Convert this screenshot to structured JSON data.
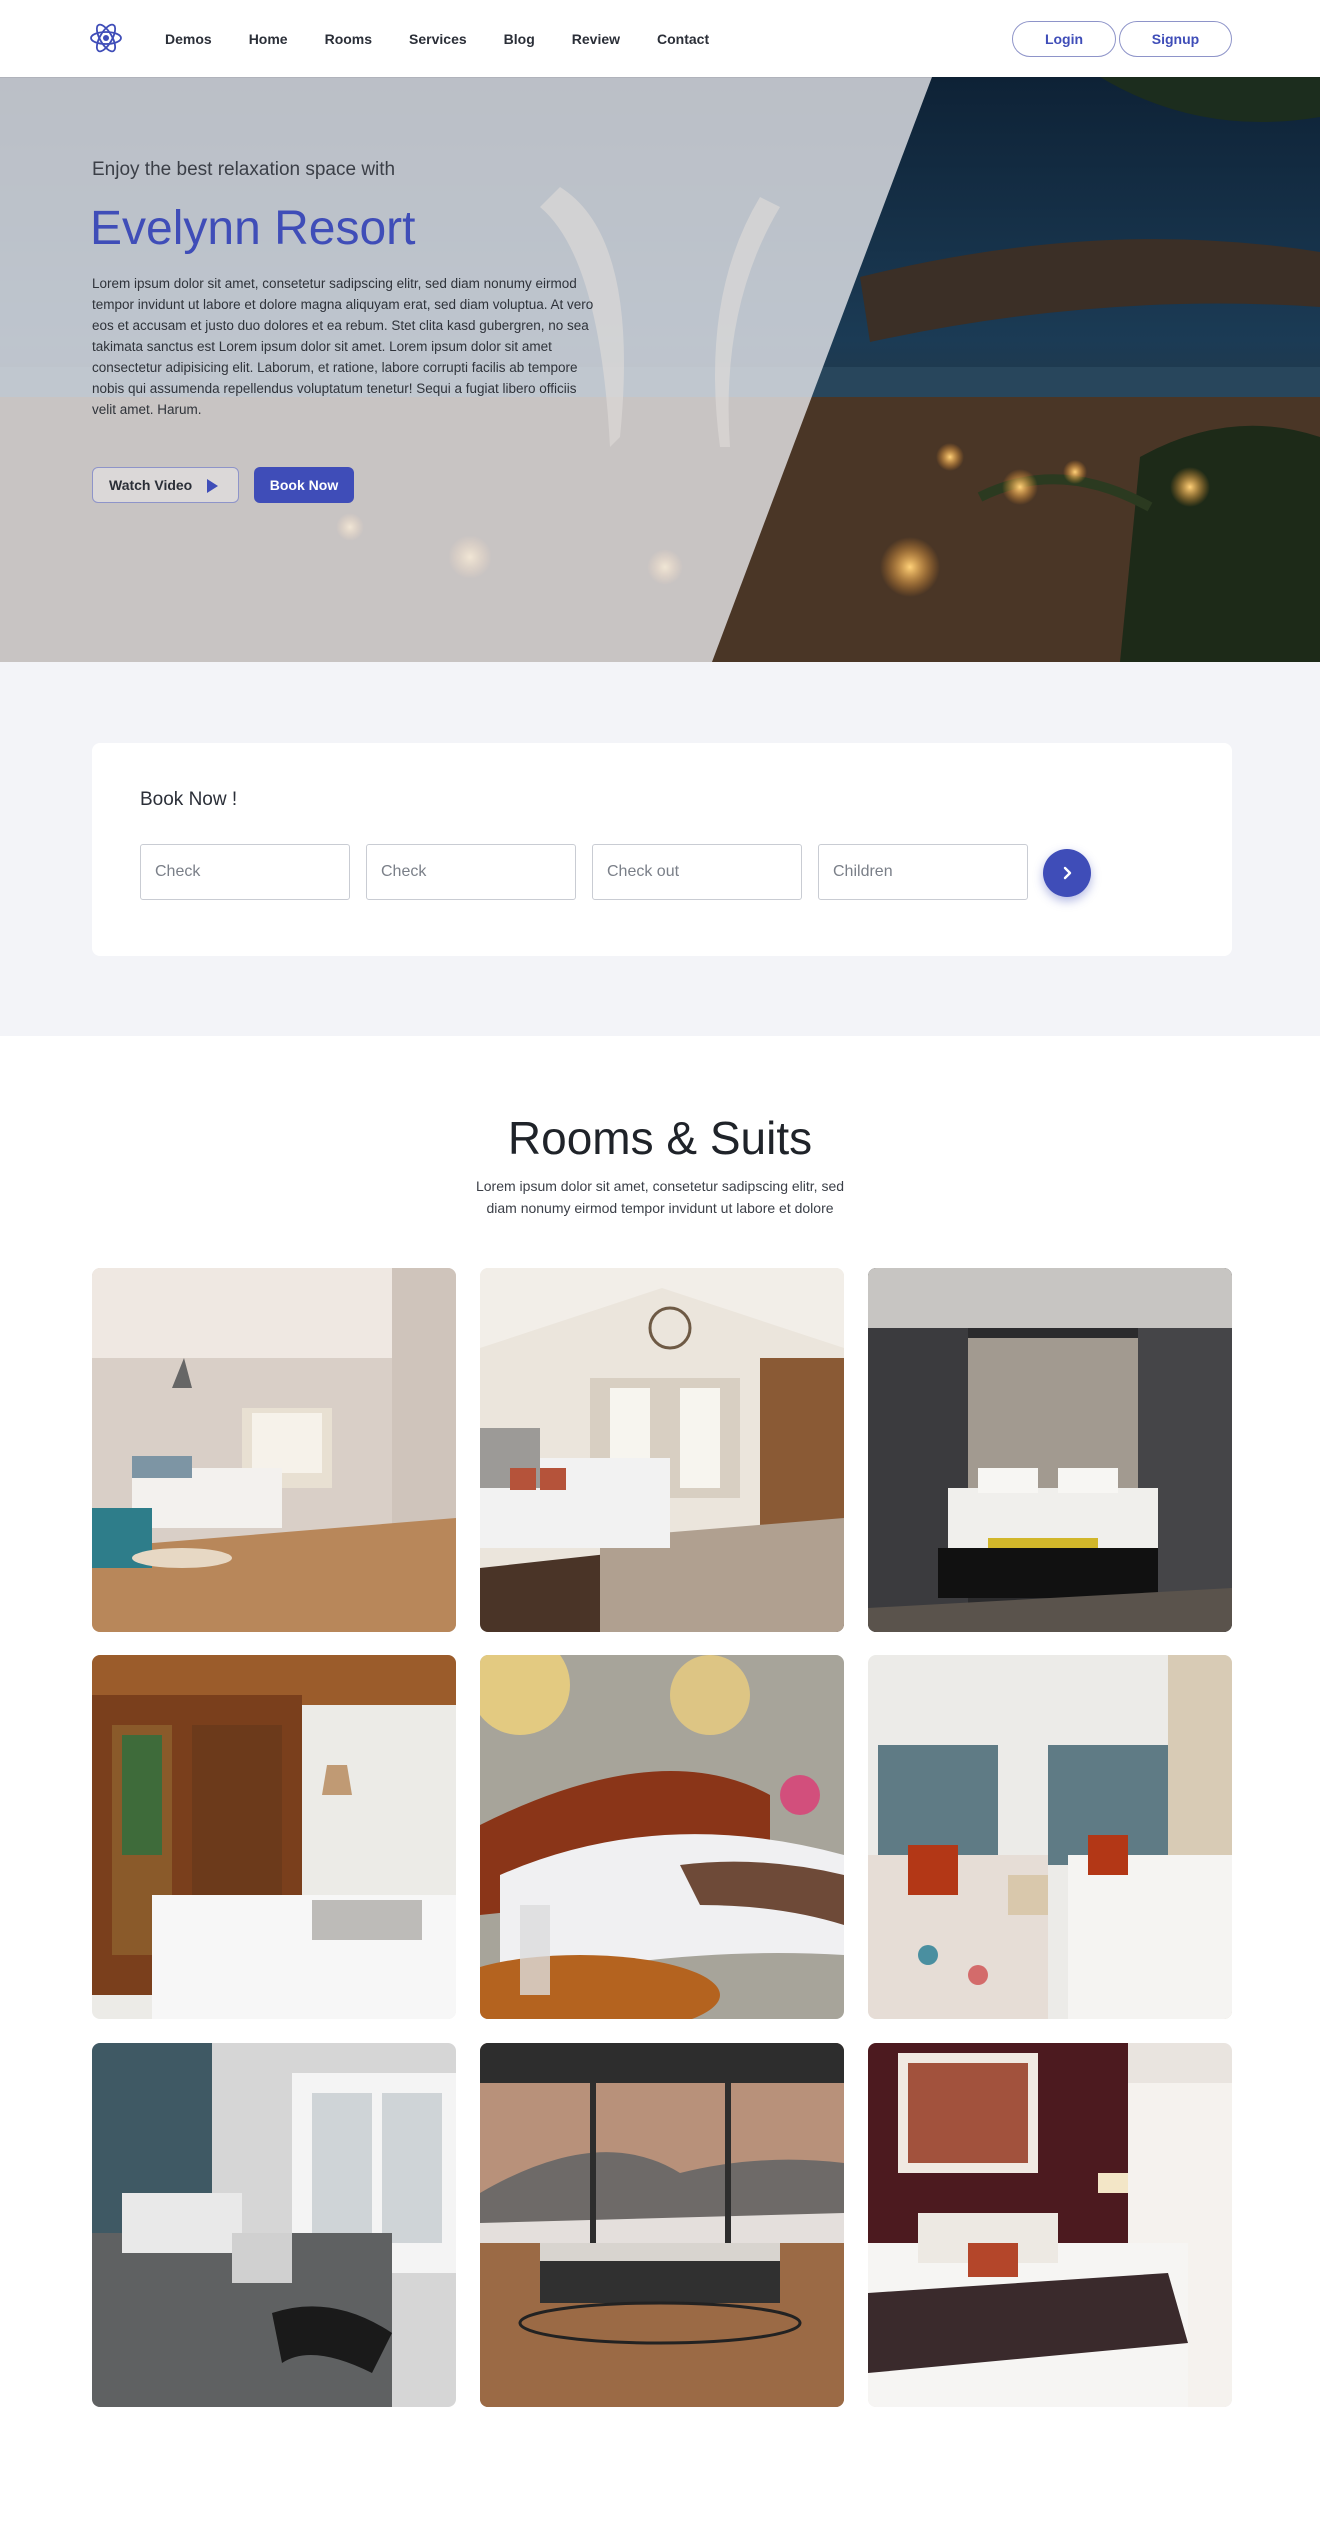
{
  "nav": {
    "logo_icon": "atom-logo-icon",
    "items": [
      "Demos",
      "Home",
      "Rooms",
      "Services",
      "Blog",
      "Review",
      "Contact"
    ],
    "login_label": "Login",
    "signup_label": "Signup"
  },
  "hero": {
    "tagline": "Enjoy the best relaxation space with",
    "title": "Evelynn Resort",
    "description": "Lorem ipsum dolor sit amet, consetetur sadipscing elitr, sed diam nonumy eirmod tempor invidunt ut labore et dolore magna aliquyam erat, sed diam voluptua. At vero eos et accusam et justo duo dolores et ea rebum. Stet clita kasd gubergren, no sea takimata sanctus est Lorem ipsum dolor sit amet. Lorem ipsum dolor sit amet consectetur adipisicing elit. Laborum, et ratione, labore corrupti facilis ab tempore nobis qui assumenda repellendus voluptatum tenetur! Sequi a fugiat libero officiis velit amet. Harum.",
    "watch_video_label": "Watch Video",
    "book_now_label": "Book Now"
  },
  "booking": {
    "title": "Book Now !",
    "fields": [
      {
        "placeholder": "Check"
      },
      {
        "placeholder": "Check"
      },
      {
        "placeholder": "Check out"
      },
      {
        "placeholder": "Children"
      }
    ],
    "submit_icon": "chevron-right-icon"
  },
  "rooms": {
    "title": "Rooms & Suits",
    "subtitle": "Lorem ipsum dolor sit amet, consetetur sadipscing elitr, sed diam nonumy eirmod tempor invidunt ut labore et dolore"
  },
  "colors": {
    "accent": "#3f4db8",
    "section_bg": "#f3f4f8"
  }
}
